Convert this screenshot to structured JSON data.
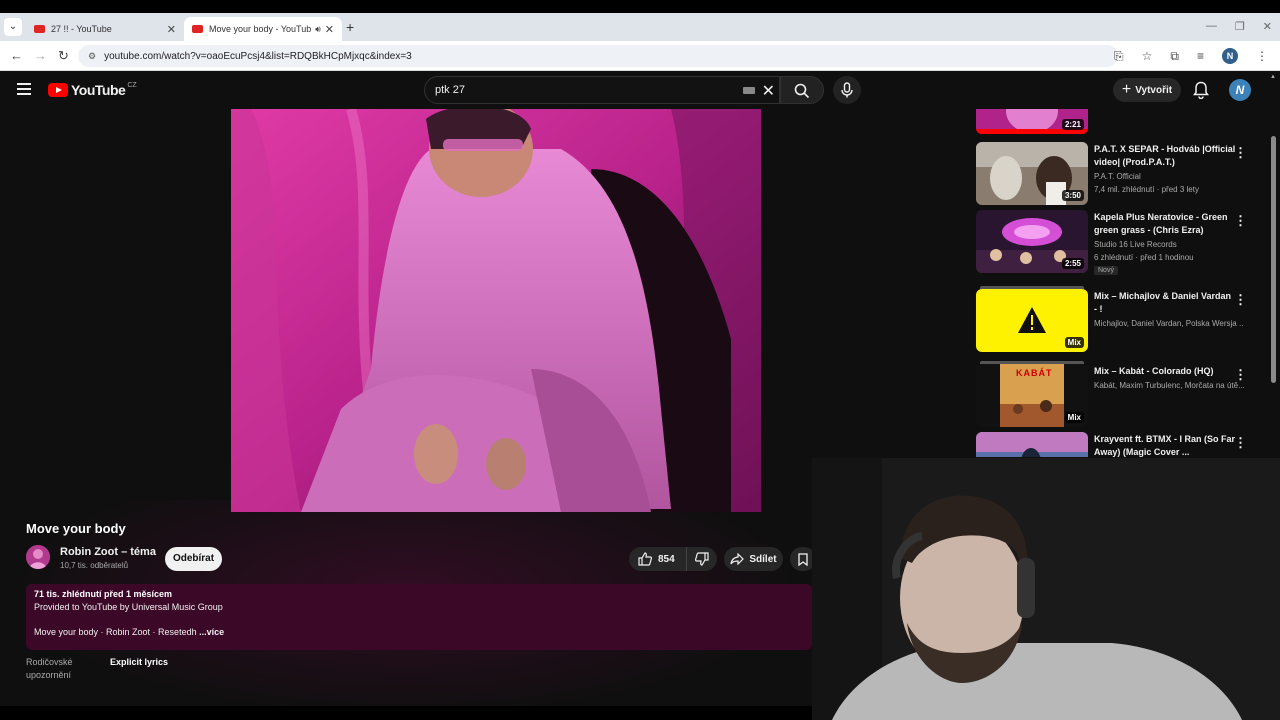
{
  "browser": {
    "tabs": [
      {
        "label": "27 !! - YouTube",
        "active": false
      },
      {
        "label": "Move your body - YouTube",
        "active": true
      }
    ],
    "url": "youtube.com/watch?v=oaoEcuPcsj4&list=RDQBkHCpMjxqc&index=3",
    "profile_initial": "N"
  },
  "youtube": {
    "logo_text": "YouTube",
    "country_code": "CZ",
    "search_value": "ptk 27",
    "create_label": "Vytvořit",
    "avatar_initial": "N"
  },
  "video": {
    "title": "Move your body",
    "channel": "Robin Zoot – téma",
    "subscribers": "10,7 tis. odběratelů",
    "subscribe_label": "Odebírat",
    "likes": "854",
    "share_label": "Sdílet",
    "description": {
      "meta": "71 tis. zhlédnutí  před 1 měsícem",
      "line1": "Provided to YouTube by Universal Music Group",
      "line2": "Move your body · Robin Zoot · Resetedh",
      "more": " ...více"
    },
    "advisory_label": "Rodičovské upozornění",
    "advisory_value": "Explicit lyrics"
  },
  "sidebar": {
    "items": [
      {
        "title": "",
        "channel": "",
        "stats": "",
        "duration": "2:21"
      },
      {
        "title": "P.A.T. X SEPAR - Hodváb |Official video| (Prod.P.A.T.)",
        "channel": "P.A.T. Official",
        "stats": "7,4 mil. zhlédnutí · před 3 lety",
        "duration": "3:50"
      },
      {
        "title": "Kapela Plus Neratovice - Green green grass - (Chris Ezra)",
        "channel": "Studio 16 Live Records",
        "stats": "6 zhlédnutí · před 1 hodinou",
        "duration": "2:55",
        "badge": "Nový"
      },
      {
        "title": "Mix – Michajlov & Daniel Vardan - !",
        "channel": "Michajlov, Daniel Vardan, Polska Wersja ...",
        "duration": "Mix"
      },
      {
        "title": "Mix – Kabát - Colorado (HQ)",
        "channel": "Kabát, Maxim Turbulenc, Morčata na útě...",
        "duration": "Mix",
        "thumb_text": "KABÁT"
      },
      {
        "title": "Krayvent ft. BTMX - I Ran (So Far Away) (Magic Cover ...",
        "channel": "",
        "duration": ""
      }
    ]
  },
  "colors": {
    "background": "#0f0f0f",
    "description_bg": "#3b0828",
    "accent_red": "#ff0000",
    "mix_yellow": "#fff200"
  }
}
